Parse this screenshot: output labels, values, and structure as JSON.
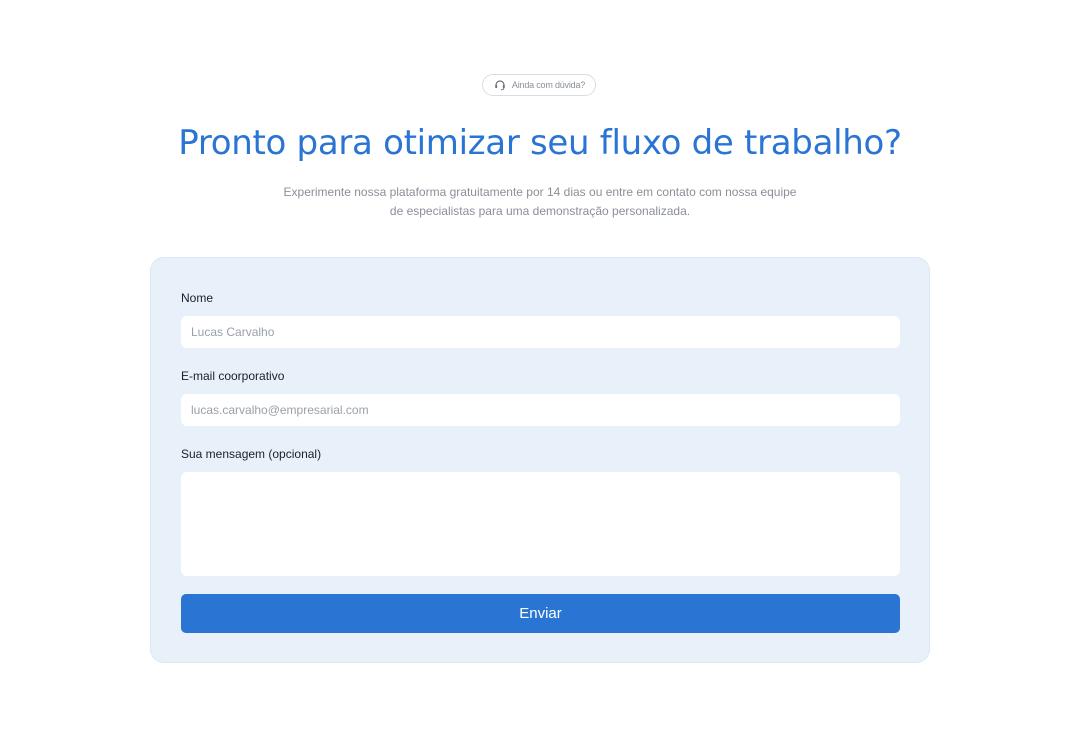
{
  "badge": {
    "icon": "headset-icon",
    "label": "Ainda com dúvida?"
  },
  "hero": {
    "title": "Pronto para otimizar seu fluxo de trabalho?",
    "subtitle_line1": "Experimente nossa plataforma gratuitamente por 14 dias ou entre em contato com nossa equipe",
    "subtitle_line2": "de especialistas para uma demonstração personalizada."
  },
  "form": {
    "name": {
      "label": "Nome",
      "placeholder": "Lucas Carvalho",
      "value": ""
    },
    "email": {
      "label": "E-mail coorporativo",
      "placeholder": "lucas.carvalho@empresarial.com",
      "value": ""
    },
    "message": {
      "label": "Sua mensagem (opcional)",
      "placeholder": "",
      "value": ""
    },
    "submit_label": "Enviar"
  },
  "colors": {
    "accent": "#2a74d4",
    "card_background": "#e8f0fa",
    "muted_text": "#8a8f98"
  }
}
